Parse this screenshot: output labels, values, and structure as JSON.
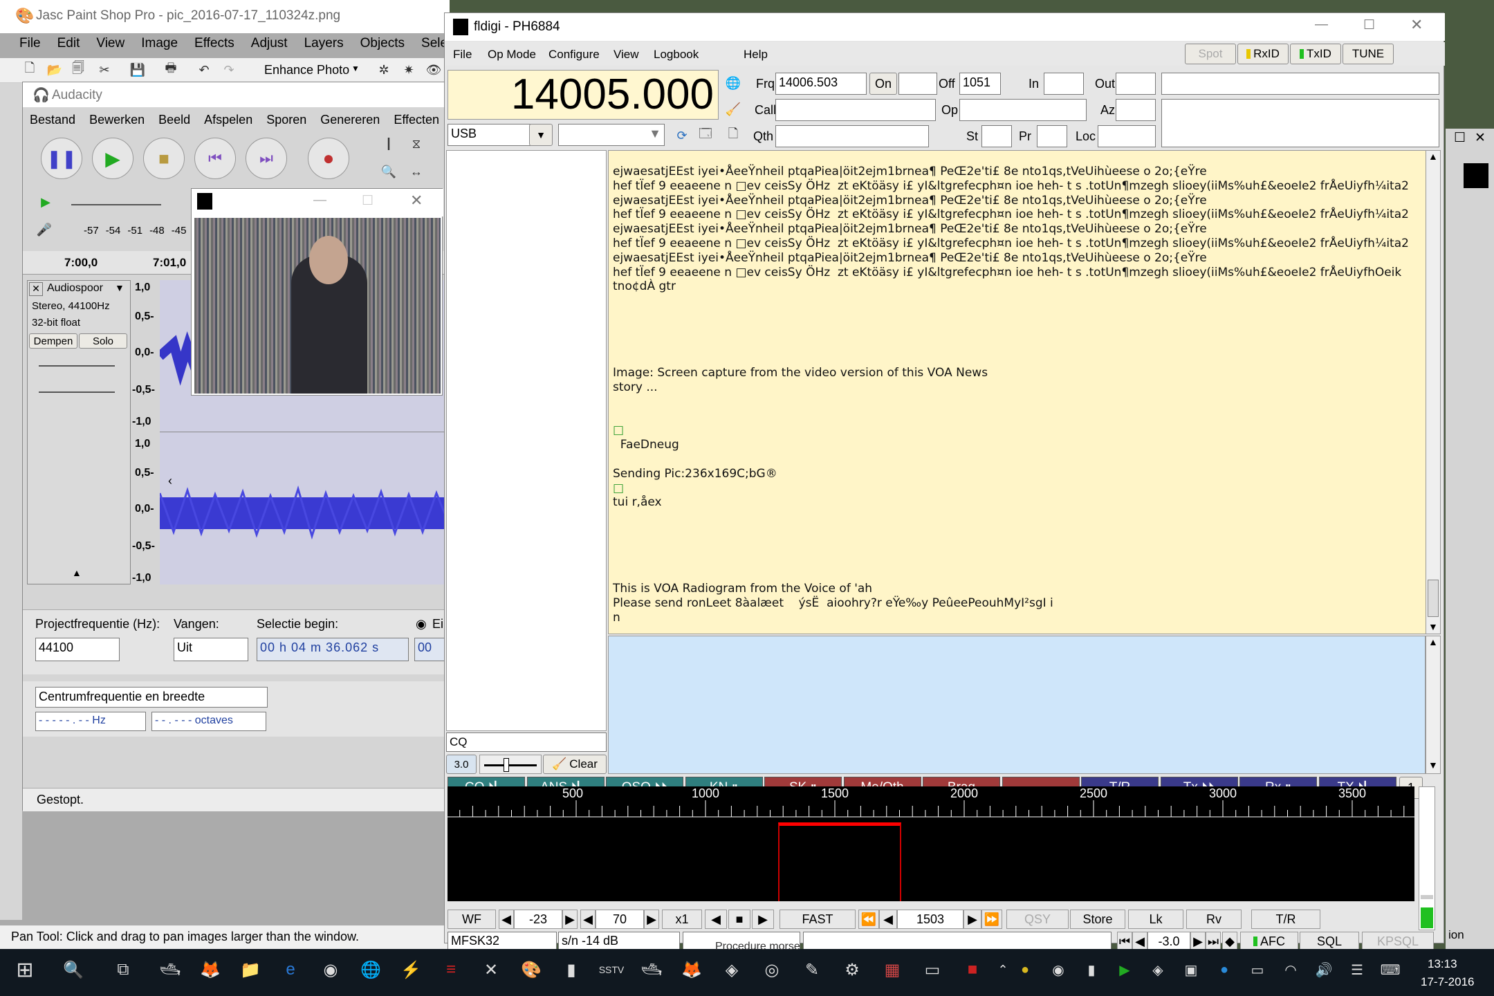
{
  "psp": {
    "title": "Jasc Paint Shop Pro - pic_2016-07-17_110324z.png",
    "menu": [
      "File",
      "Edit",
      "View",
      "Image",
      "Effects",
      "Adjust",
      "Layers",
      "Objects",
      "Selec"
    ],
    "enhance": "Enhance Photo",
    "status": "Pan Tool: Click and drag to pan images larger than the window."
  },
  "audacity": {
    "title": "Audacity",
    "menu": [
      "Bestand",
      "Bewerken",
      "Beeld",
      "Afspelen",
      "Sporen",
      "Genereren",
      "Effecten"
    ],
    "meter": [
      "-57",
      "-54",
      "-51",
      "-48",
      "-45"
    ],
    "timeline": [
      "7:00,0",
      "7:01,0"
    ],
    "track": {
      "name": "Audiospoor",
      "info1": "Stereo, 44100Hz",
      "info2": "32-bit float",
      "mute": "Dempen",
      "solo": "Solo"
    },
    "scale1": [
      "1,0",
      "0,5-",
      "0,0-",
      "-0,5-",
      "-1,0"
    ],
    "scale2": [
      "1,0",
      "0,5-",
      "0,0-",
      "-0,5-",
      "-1,0"
    ],
    "proj_label": "Projectfrequentie (Hz):",
    "proj_value": "44100",
    "snap_label": "Vangen:",
    "snap_value": "Uit",
    "sel_label": "Selectie begin:",
    "sel_value": "00 h 04 m 36.062 s",
    "sel_value2": "00",
    "radio_label": "Ei",
    "spectrum_select": "Centrumfrequentie en breedte",
    "hz_field": "- - - - - . - -  Hz",
    "oct_field": "- - . - - -   octaves",
    "status": "Gestopt."
  },
  "fldigi": {
    "title": "fldigi - PH6884",
    "menu": [
      "File",
      "Op Mode",
      "Configure",
      "View",
      "Logbook",
      "Help"
    ],
    "spot": "Spot",
    "rxid": "RxID",
    "txid": "TxID",
    "tune": "TUNE",
    "freq_display": "14005.000",
    "mode": "USB",
    "frq_label": "Frq",
    "frq_value": "14006.503",
    "on_label": "On",
    "off_label": "Off",
    "off_value": "1051",
    "in_label": "In",
    "out_label": "Out",
    "call_label": "Call",
    "op_label": "Op",
    "az_label": "Az",
    "qth_label": "Qth",
    "st_label": "St",
    "pr_label": "Pr",
    "loc_label": "Loc",
    "rx_lines": [
      "ejwaesatjEEst iyei•ÅeeŸnheil ptqaPiea|öit2ejm1brnea¶ PeŒ2e'ti£ 8e nto1qs,tVeUihùeese o 2o;{eŸre",
      "hef tÏef 9 eeaeene n □ev ceisSy ÖHz  zt eKtöäsy i£ yI&ltgrefecph¤n ioe heh- t s .totUn¶mzegh slioey(iiMs%uh£&eoeIe2 frÅeUiyfh¼ita2",
      "ejwaesatjEEst iyei•ÅeeŸnheil ptqaPiea|öit2ejm1brnea¶ PeŒ2e'ti£ 8e nto1qs,tVeUihùeese o 2o;{eŸre",
      "hef tÏef 9 eeaeene n □ev ceisSy ÖHz  zt eKtöäsy i£ yI&ltgrefecph¤n ioe heh- t s .totUn¶mzegh slioey(iiMs%uh£&eoeIe2 frÅeUiyfh¼ita2",
      "ejwaesatjEEst iyei•ÅeeŸnheil ptqaPiea|öit2ejm1brnea¶ PeŒ2e'ti£ 8e nto1qs,tVeUihùeese o 2o;{eŸre",
      "hef tÏef 9 eeaeene n □ev ceisSy ÖHz  zt eKtöäsy i£ yI&ltgrefecph¤n ioe heh- t s .totUn¶mzegh slioey(iiMs%uh£&eoeIe2 frÅeUiyfh¼ita2",
      "ejwaesatjEEst iyei•ÅeeŸnheil ptqaPiea|öit2ejm1brnea¶ PeŒ2e'ti£ 8e nto1qs,tVeUihùeese o 2o;{eŸre",
      "hef tÏef 9 eeaeene n □ev ceisSy ÖHz  zt eKtöäsy i£ yI&ltgrefecph¤n ioe heh- t s .totUn¶mzegh slioey(iiMs%uh£&eoeIe2 frÅeUiyfhOeik",
      "tno¢dÀ gtr",
      "",
      "",
      "",
      "",
      "",
      "Image: Screen capture from the video version of this VOA News",
      "story ...",
      "",
      "",
      "□",
      "  FaeDneug",
      "",
      "Sending Pic:236x169C;bG®",
      "□",
      "tui r,åex",
      "",
      "",
      "",
      "",
      "",
      "This is VOA Radiogram from the Voice of 'ah",
      "Please send ronLeet 8àalæet    ýsË  aioohry?r eŸe‰y PeûeePeouhMyI²sgI i",
      "n"
    ],
    "tx_cq": "CQ",
    "squelch_val": "3.0",
    "clear": "Clear",
    "macros": [
      "CQ ⏵▏",
      "ANS ⏵▏",
      "QSO ⏵⏵",
      "KN ⏸",
      "SK ⏸",
      "Me/Qth",
      "Brag",
      "",
      "T/R",
      "Tx ⏵⏵",
      "Rx ⏸",
      "TX ⏵▏"
    ],
    "macro_set": "1",
    "scale": [
      "500",
      "1000",
      "1500",
      "2000",
      "2500",
      "3000",
      "3500"
    ],
    "wf": "WF",
    "wf_lo": "-23",
    "wf_range": "70",
    "x1": "x1",
    "fast": "FAST",
    "wf_freq": "1503",
    "qsy": "QSY",
    "store": "Store",
    "lk": "Lk",
    "rv": "Rv",
    "tr": "T/R",
    "mode_name": "MFSK32",
    "sn": "s/n -14 dB",
    "afc_val": "-3.0",
    "afc": "AFC",
    "sql": "SQL",
    "kpsql": "KPSQL"
  },
  "taskbar": {
    "time": "13:13",
    "date": "17-7-2016",
    "behind_text": "Procedure morse",
    "side_text": "ion"
  },
  "colors": {
    "fldigi_rx": "#fff5c8",
    "fldigi_tx": "#cfe6fa",
    "macro_green": "#2f7f7f",
    "macro_red": "#a03a3a",
    "macro_blue": "#3a3a8a"
  }
}
